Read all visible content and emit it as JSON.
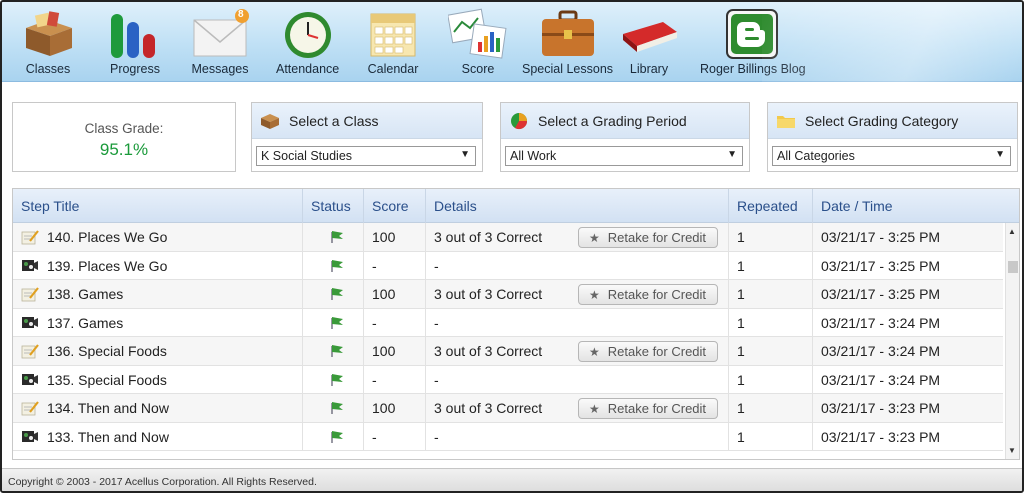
{
  "toolbar": {
    "items": [
      {
        "label": "Classes",
        "icon": "classes-box-icon"
      },
      {
        "label": "Progress",
        "icon": "progress-bars-icon"
      },
      {
        "label": "Messages",
        "icon": "envelope-icon",
        "badge": "8"
      },
      {
        "label": "Attendance",
        "icon": "clock-icon"
      },
      {
        "label": "Calendar",
        "icon": "calendar-icon"
      },
      {
        "label": "Score",
        "icon": "score-chart-icon"
      },
      {
        "label": "Special Lessons",
        "icon": "briefcase-icon"
      },
      {
        "label": "Library",
        "icon": "book-icon"
      },
      {
        "label": "Roger Billings Blog",
        "icon": "blogger-icon"
      }
    ]
  },
  "grade": {
    "label": "Class Grade:",
    "value": "95.1%"
  },
  "selectors": {
    "class": {
      "title": "Select a Class",
      "value": "K Social Studies"
    },
    "period": {
      "title": "Select a Grading Period",
      "value": "All Work"
    },
    "category": {
      "title": "Select Grading Category",
      "value": "All Categories"
    }
  },
  "table": {
    "headers": [
      "Step Title",
      "Status",
      "Score",
      "Details",
      "Repeated",
      "Date / Time"
    ],
    "retake_label": "Retake for Credit",
    "rows": [
      {
        "title": "140. Places We Go",
        "type": "quiz",
        "score": "100",
        "details": "3 out of 3 Correct",
        "retake": true,
        "repeated": "1",
        "date": "03/21/17 - 3:25 PM"
      },
      {
        "title": "139. Places We Go",
        "type": "video",
        "score": "-",
        "details": "-",
        "retake": false,
        "repeated": "1",
        "date": "03/21/17 - 3:25 PM"
      },
      {
        "title": "138. Games",
        "type": "quiz",
        "score": "100",
        "details": "3 out of 3 Correct",
        "retake": true,
        "repeated": "1",
        "date": "03/21/17 - 3:25 PM"
      },
      {
        "title": "137. Games",
        "type": "video",
        "score": "-",
        "details": "-",
        "retake": false,
        "repeated": "1",
        "date": "03/21/17 - 3:24 PM"
      },
      {
        "title": "136. Special Foods",
        "type": "quiz",
        "score": "100",
        "details": "3 out of 3 Correct",
        "retake": true,
        "repeated": "1",
        "date": "03/21/17 - 3:24 PM"
      },
      {
        "title": "135. Special Foods",
        "type": "video",
        "score": "-",
        "details": "-",
        "retake": false,
        "repeated": "1",
        "date": "03/21/17 - 3:24 PM"
      },
      {
        "title": "134. Then and Now",
        "type": "quiz",
        "score": "100",
        "details": "3 out of 3 Correct",
        "retake": true,
        "repeated": "1",
        "date": "03/21/17 - 3:23 PM"
      },
      {
        "title": "133. Then and Now",
        "type": "video",
        "score": "-",
        "details": "-",
        "retake": false,
        "repeated": "1",
        "date": "03/21/17 - 3:23 PM"
      }
    ]
  },
  "footer": {
    "copyright": "Copyright © 2003 - 2017 Acellus Corporation.  All Rights Reserved."
  },
  "colors": {
    "grade_green": "#1a9a3a",
    "header_blue": "#2a4f8a"
  }
}
